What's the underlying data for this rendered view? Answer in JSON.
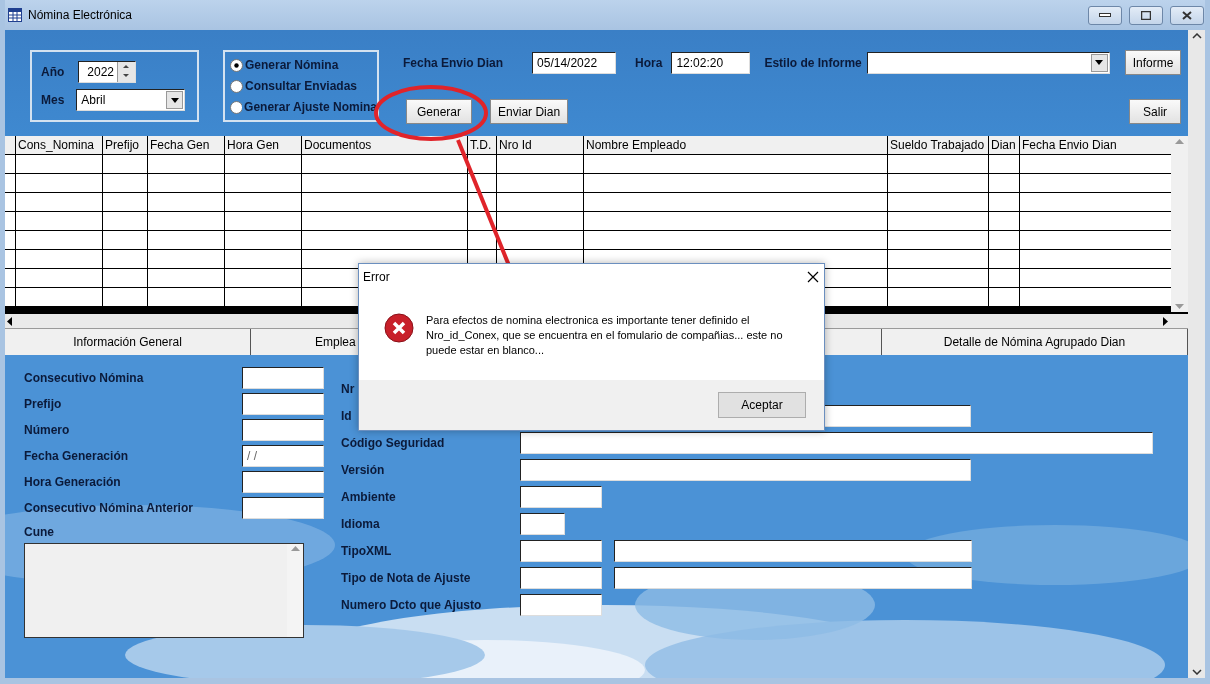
{
  "window": {
    "title": "Nómina Electrónica"
  },
  "period": {
    "year_label": "Año",
    "year": "2022",
    "month_label": "Mes",
    "month": "Abril"
  },
  "modes": [
    {
      "label": "Generar Nómina",
      "selected": true
    },
    {
      "label": "Consultar Enviadas",
      "selected": false
    },
    {
      "label": "Generar Ajuste Nomina",
      "selected": false
    }
  ],
  "send": {
    "date_label": "Fecha Envio Dian",
    "date": "05/14/2022",
    "time_label": "Hora",
    "time": "12:02:20",
    "style_label": "Estilo de Informe"
  },
  "buttons": {
    "report": "Informe",
    "generate": "Generar",
    "send": "Enviar Dian",
    "exit": "Salir"
  },
  "table": {
    "columns": [
      "Cons_Nomina",
      "Prefijo",
      "Fecha Gen",
      "Hora Gen",
      "Documentos",
      "T.D.",
      "Nro Id",
      "Nombre Empleado",
      "Sueldo Trabajado",
      "Dian",
      "Fecha Envio Dian"
    ]
  },
  "tabs": [
    {
      "label": "Información General"
    },
    {
      "label": "Emplea"
    },
    {
      "label": "Detalle de Nómina Agrupado Dian"
    }
  ],
  "left_fields": [
    {
      "label": "Consecutivo Nómina"
    },
    {
      "label": "Prefijo"
    },
    {
      "label": "Número"
    },
    {
      "label": "Fecha Generación",
      "value": "/ /"
    },
    {
      "label": "Hora Generación"
    },
    {
      "label": "Consecutivo Nómina Anterior"
    }
  ],
  "cune": {
    "label": "Cune"
  },
  "right_fields": [
    {
      "label": "Nr",
      "kind": "none"
    },
    {
      "label": "Id",
      "kind": "wide"
    },
    {
      "label": "Código Seguridad",
      "kind": "full"
    },
    {
      "label": "Versión",
      "kind": "wide"
    },
    {
      "label": "Ambiente",
      "kind": "short"
    },
    {
      "label": "Idioma",
      "kind": "tiny"
    },
    {
      "label": "TipoXML",
      "kind": "pair"
    },
    {
      "label": "Tipo de Nota de Ajuste",
      "kind": "pair"
    },
    {
      "label": "Numero Dcto que Ajusto",
      "kind": "short"
    }
  ],
  "dialog": {
    "title": "Error",
    "message": "Para efectos de nomina electronica es importante tener definido el Nro_id_Conex, que se encuentra en el fomulario de compañias... este no puede estar en blanco...",
    "button": "Aceptar"
  }
}
